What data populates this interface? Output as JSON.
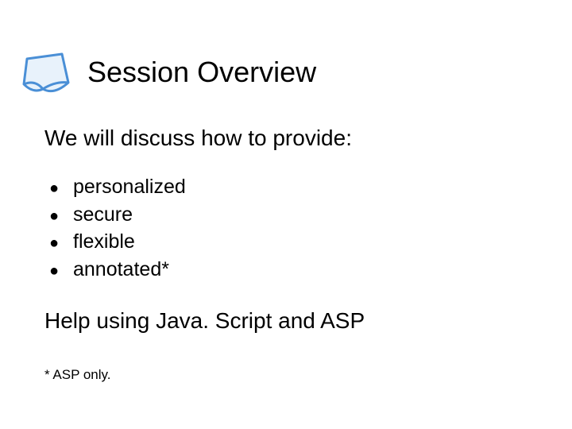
{
  "title": "Session Overview",
  "intro": "We will discuss how to provide:",
  "bullets": [
    "personalized",
    "secure",
    "flexible",
    "annotated*"
  ],
  "closing": "Help using Java. Script and ASP",
  "footnote": "* ASP only.",
  "icon": "paper-icon",
  "colors": {
    "icon_stroke": "#4a8fd6",
    "icon_fill": "#e8f2fb"
  }
}
